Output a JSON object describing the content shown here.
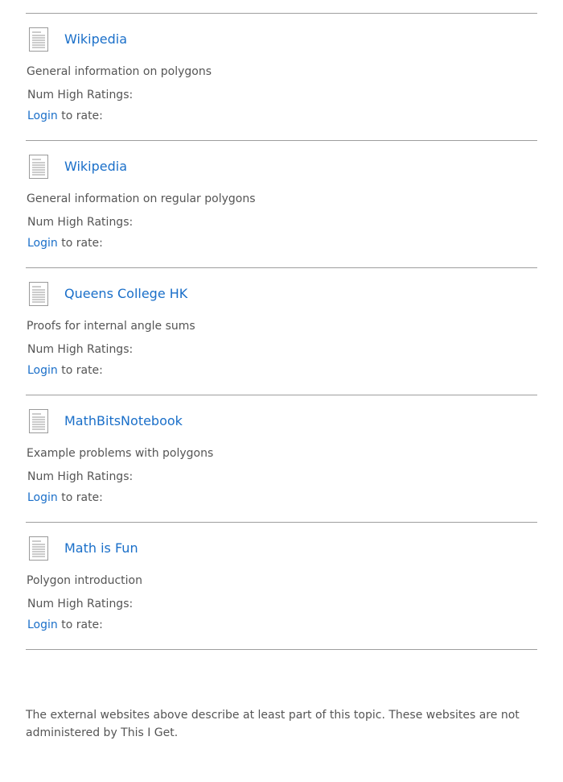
{
  "resources": [
    {
      "icon": "document-icon",
      "title": "Wikipedia",
      "description": "General information on polygons",
      "ratings_label": "Num High Ratings:",
      "login_label": "Login",
      "rate_suffix": " to rate:"
    },
    {
      "icon": "document-icon",
      "title": "Wikipedia",
      "description": "General information on regular polygons",
      "ratings_label": "Num High Ratings:",
      "login_label": "Login",
      "rate_suffix": " to rate:"
    },
    {
      "icon": "document-icon",
      "title": "Queens College HK",
      "description": "Proofs for internal angle sums",
      "ratings_label": "Num High Ratings:",
      "login_label": "Login",
      "rate_suffix": " to rate:"
    },
    {
      "icon": "document-icon",
      "title": "MathBitsNotebook",
      "description": "Example problems with polygons",
      "ratings_label": "Num High Ratings:",
      "login_label": "Login",
      "rate_suffix": " to rate:"
    },
    {
      "icon": "document-icon",
      "title": "Math is Fun",
      "description": "Polygon introduction",
      "ratings_label": "Num High Ratings:",
      "login_label": "Login",
      "rate_suffix": " to rate:"
    }
  ],
  "footer": {
    "note": "The external websites above describe at least part of this topic. These websites are not administered by This I Get."
  },
  "colors": {
    "link": "#1a6fc9",
    "text": "#555555",
    "divider": "#9e9e9e",
    "icon": "#9a9a9a"
  }
}
